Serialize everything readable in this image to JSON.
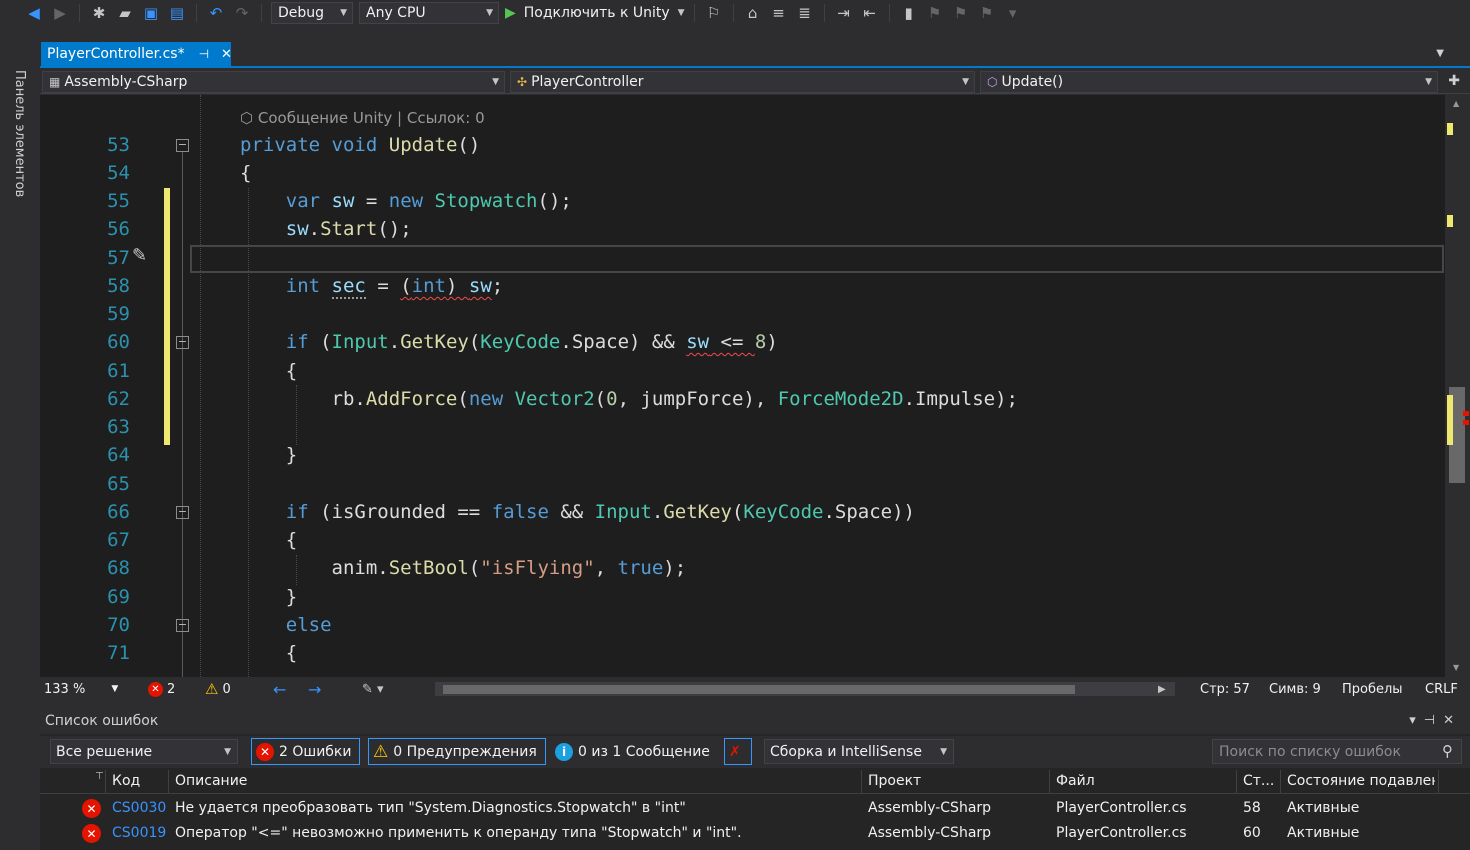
{
  "toolbar": {
    "config": "Debug",
    "platform": "Any CPU",
    "run_label": "Подключить к Unity"
  },
  "left_panel": {
    "label": "Панель элементов"
  },
  "tab": {
    "title": "PlayerController.cs*",
    "pin": "⊣",
    "close": "✕"
  },
  "navbar": {
    "project": "Assembly-CSharp",
    "class": "PlayerController",
    "member": "Update()"
  },
  "editor": {
    "codelens": "⬡ Сообщение Unity | Ссылок: 0",
    "line_numbers": [
      "53",
      "54",
      "55",
      "56",
      "57",
      "58",
      "59",
      "60",
      "61",
      "62",
      "63",
      "64",
      "65",
      "66",
      "67",
      "68",
      "69",
      "70",
      "71"
    ]
  },
  "status": {
    "zoom": "133 %",
    "errors": "2",
    "warnings": "0",
    "line": "Стр: 57",
    "col": "Симв: 9",
    "whitespace": "Пробелы",
    "eol": "CRLF"
  },
  "error_list": {
    "title": "Список ошибок",
    "scope": "Все решение",
    "errors_btn": "2 Ошибки",
    "warnings_btn": "0 Предупреждения",
    "messages_btn": "0 из 1 Сообщение",
    "build_filter": "Сборка и IntelliSense",
    "search_placeholder": "Поиск по списку ошибок",
    "columns": [
      "Код",
      "Описание",
      "Проект",
      "Файл",
      "Ст...",
      "Состояние подавлен"
    ],
    "rows": [
      {
        "code": "CS0030",
        "description": "Не удается преобразовать тип \"System.Diagnostics.Stopwatch\" в \"int\"",
        "project": "Assembly-CSharp",
        "file": "PlayerController.cs",
        "line": "58",
        "state": "Активные"
      },
      {
        "code": "CS0019",
        "description": "Оператор \"<=\" невозможно применить к операнду типа \"Stopwatch\" и \"int\".",
        "project": "Assembly-CSharp",
        "file": "PlayerController.cs",
        "line": "60",
        "state": "Активные"
      }
    ]
  }
}
